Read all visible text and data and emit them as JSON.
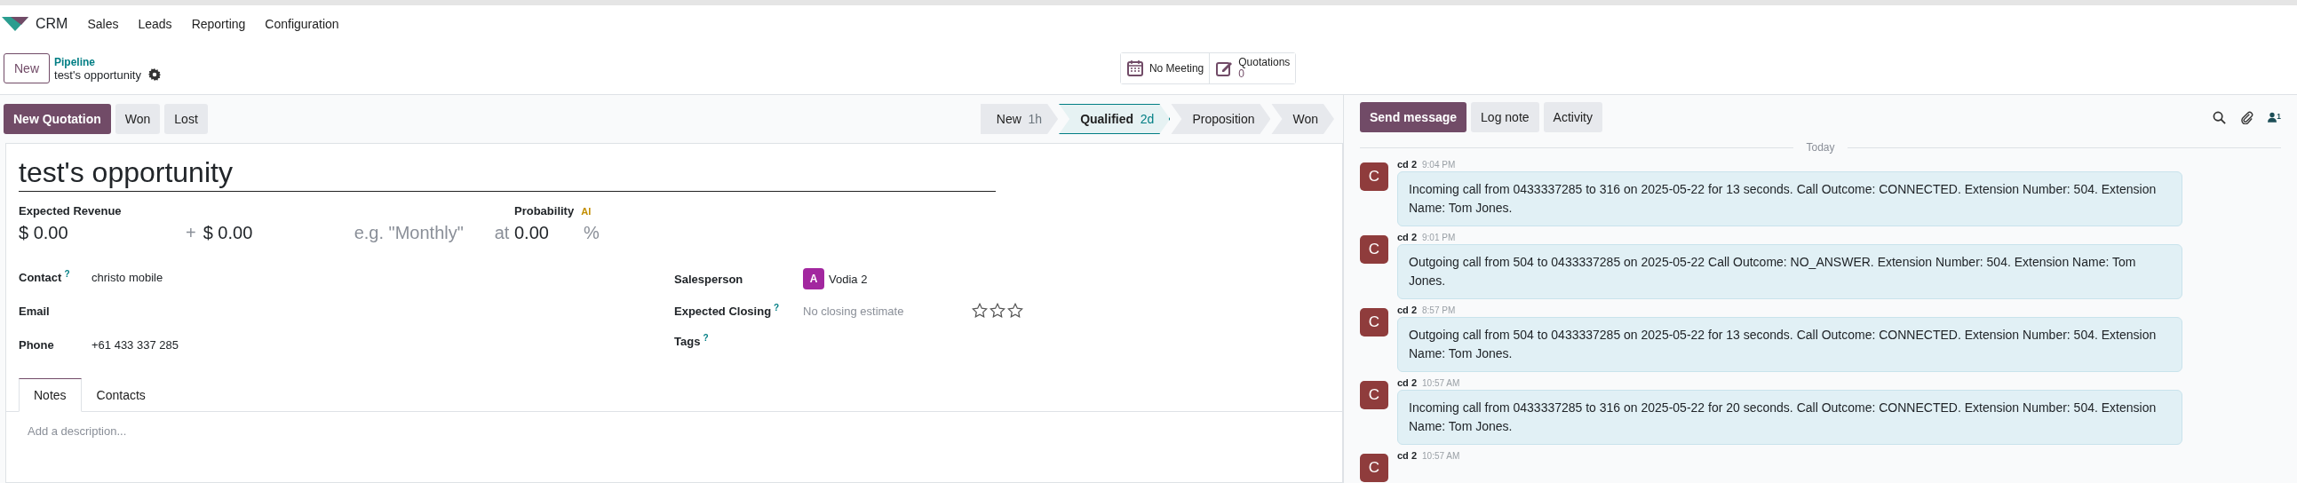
{
  "app_menu": {
    "app_name": "CRM",
    "items": [
      "Sales",
      "Leads",
      "Reporting",
      "Configuration"
    ]
  },
  "control_panel": {
    "new_button": "New",
    "breadcrumb_parent": "Pipeline",
    "breadcrumb_current": "test's opportunity"
  },
  "smart_buttons": [
    {
      "kind": "meeting",
      "label": "No Meeting"
    },
    {
      "kind": "quotations",
      "label": "Quotations",
      "count": "0"
    }
  ],
  "action_buttons": [
    {
      "label": "New Quotation",
      "primary": true
    },
    {
      "label": "Won",
      "primary": false
    },
    {
      "label": "Lost",
      "primary": false
    }
  ],
  "stages": [
    {
      "label": "New",
      "duration": "1h",
      "selected": false
    },
    {
      "label": "Qualified",
      "duration": "2d",
      "selected": true
    },
    {
      "label": "Proposition",
      "selected": false
    },
    {
      "label": "Won",
      "selected": false
    }
  ],
  "form": {
    "title": "test's opportunity",
    "expected_revenue": {
      "label": "Expected Revenue",
      "value": "$ 0.00",
      "plus": "+",
      "recurring": "$ 0.00",
      "plan_placeholder": "e.g. \"Monthly\"",
      "at": "at"
    },
    "probability": {
      "label": "Probability",
      "ai_badge": "AI",
      "value": "0.00",
      "unit": "%"
    },
    "left_fields": [
      {
        "label": "Contact",
        "help": "?",
        "value": "christo mobile"
      },
      {
        "label": "Email"
      },
      {
        "label": "Phone",
        "value": "+61 433 337 285"
      }
    ],
    "salesperson": {
      "label": "Salesperson",
      "initial": "A",
      "color": "#a2279f",
      "name": "Vodia 2"
    },
    "expected_closing": {
      "label": "Expected Closing",
      "help": "?",
      "placeholder": "No closing estimate",
      "stars": 0
    },
    "tags": {
      "label": "Tags",
      "help": "?"
    },
    "tabs": [
      {
        "label": "Notes",
        "selected": true
      },
      {
        "label": "Contacts",
        "selected": false
      }
    ],
    "notes_placeholder": "Add a description..."
  },
  "chatter": {
    "buttons": [
      {
        "label": "Send message",
        "primary": true
      },
      {
        "label": "Log note",
        "primary": false
      },
      {
        "label": "Activity",
        "primary": false
      }
    ],
    "follower_count": "1",
    "date_separator": "Today",
    "messages": [
      {
        "initial": "C",
        "author": "cd 2",
        "time": "9:04 PM",
        "body": "Incoming call from 0433337285 to 316 on 2025-05-22 for 13 seconds. Call Outcome: CONNECTED. Extension Number: 504. Extension Name: Tom Jones."
      },
      {
        "initial": "C",
        "author": "cd 2",
        "time": "9:01 PM",
        "body": "Outgoing call from 504 to 0433337285 on 2025-05-22 Call Outcome: NO_ANSWER. Extension Number: 504. Extension Name: Tom Jones."
      },
      {
        "initial": "C",
        "author": "cd 2",
        "time": "8:57 PM",
        "body": "Outgoing call from 504 to 0433337285 on 2025-05-22 for 13 seconds. Call Outcome: CONNECTED. Extension Number: 504. Extension Name: Tom Jones."
      },
      {
        "initial": "C",
        "author": "cd 2",
        "time": "10:57 AM",
        "body": "Incoming call from 0433337285 to 316 on 2025-05-22 for 20 seconds. Call Outcome: CONNECTED. Extension Number: 504. Extension Name: Tom Jones."
      },
      {
        "initial": "C",
        "author": "cd 2",
        "time": "10:57 AM"
      }
    ]
  }
}
